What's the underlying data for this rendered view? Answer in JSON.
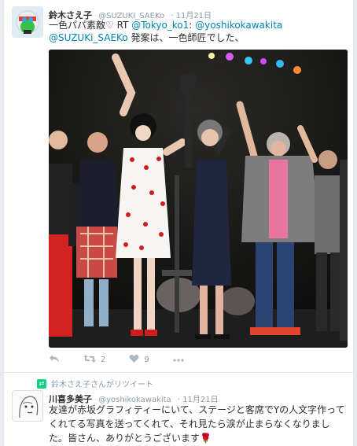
{
  "tweet1": {
    "display_name": "鈴木さえ子",
    "handle": "@SUZUKI_SAEKo",
    "date": "· 11月21日",
    "text_part1": "一色パパ素敵♡  RT ",
    "mention1": "@Tokyo_ko1",
    "colon1": ": ",
    "mention2": "@yoshikokawakita",
    "mention3": "@SUZUKi_SAEKo",
    "text_part2": " 発案は、一色師匠でした、",
    "retweet_count": "2",
    "like_count": "9"
  },
  "retweet_banner": {
    "label": "鈴木さえ子さんがリツイート"
  },
  "tweet2": {
    "display_name": "川喜多美子",
    "handle": "@yoshikokawakita",
    "date": "· 11月21日",
    "text": "友達が赤坂グラフィティーにいて、ステージと客席でYの人文字作ってくれてる写真を送ってくれて、それ見たら涙が止まらなくなりました。皆さん、ありがとうございます🌹"
  },
  "colors": {
    "link": "#0084b4",
    "muted": "#8899a6",
    "retweet_green": "#19cf86",
    "like_red": "#e81c4f"
  }
}
